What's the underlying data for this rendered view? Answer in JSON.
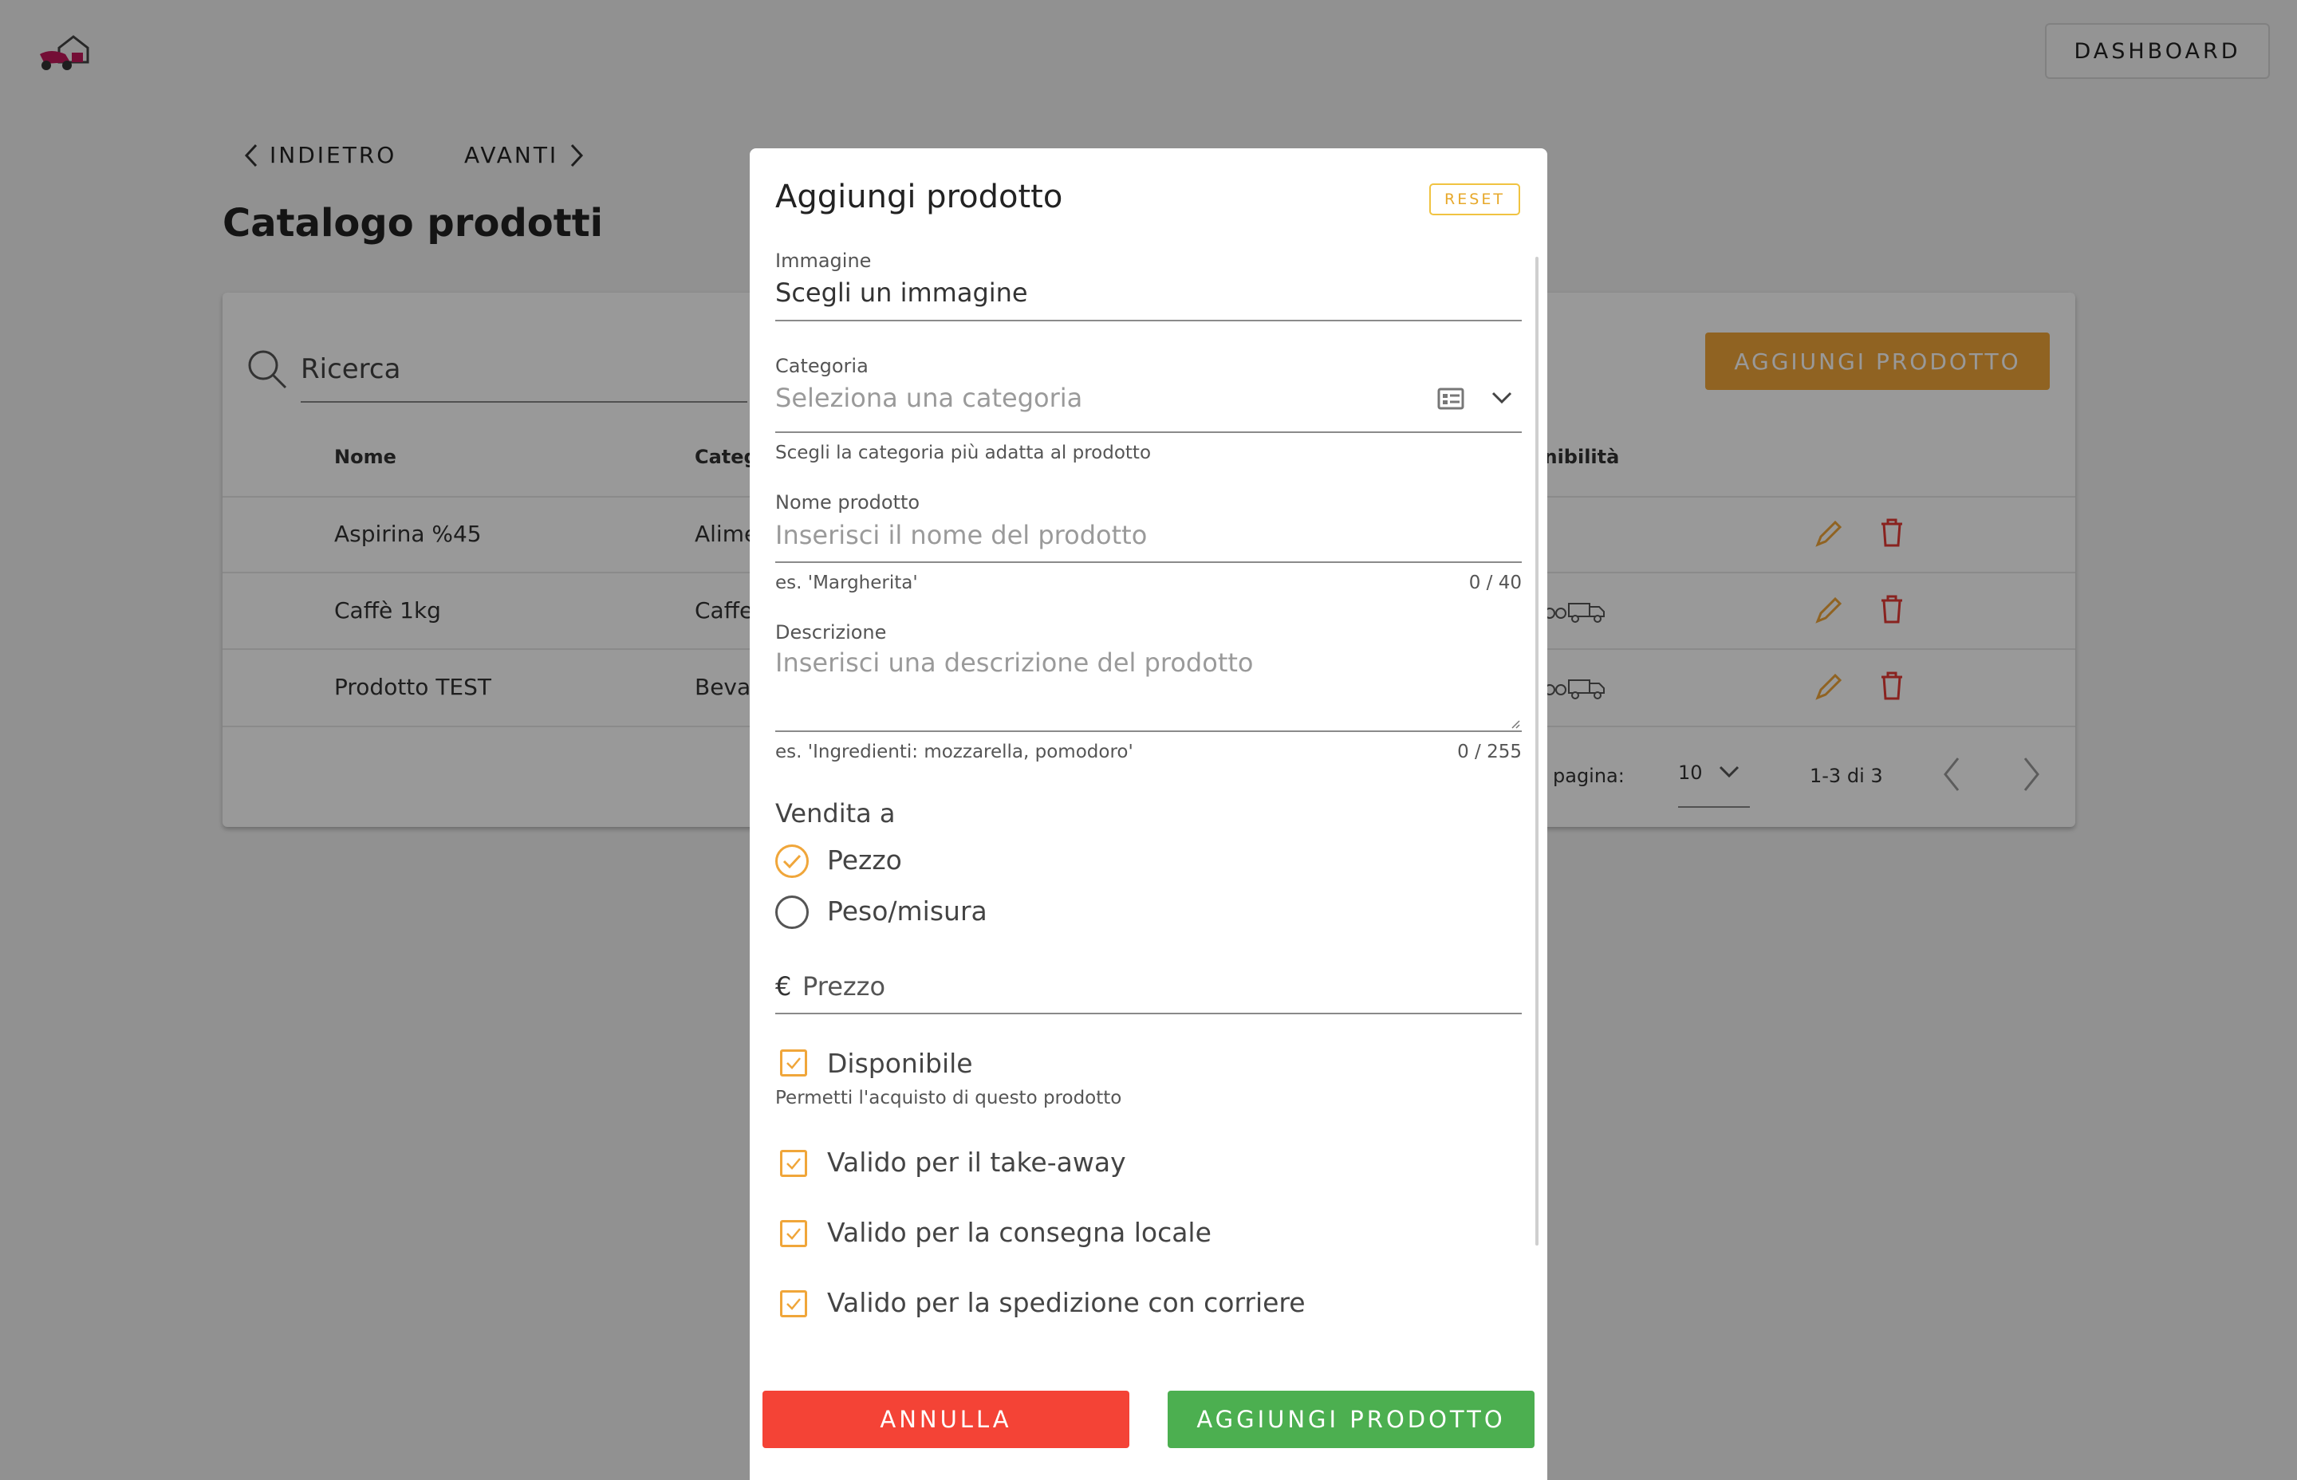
{
  "header": {
    "dashboard_label": "DASHBOARD"
  },
  "nav": {
    "back_label": "INDIETRO",
    "forward_label": "AVANTI"
  },
  "page": {
    "title": "Catalogo prodotti"
  },
  "catalog": {
    "search_placeholder": "Ricerca",
    "add_button_label": "AGGIUNGI PRODOTTO",
    "columns": {
      "name": "Nome",
      "category": "Categ",
      "availability": "onibilità"
    },
    "rows": [
      {
        "name": "Aspirina %45",
        "category": "Alime"
      },
      {
        "name": "Caffè 1kg",
        "category": "Caffe"
      },
      {
        "name": "Prodotto TEST",
        "category": "Beva"
      }
    ],
    "pagination": {
      "rows_label": "pagina:",
      "rows_value": "10",
      "range": "1-3 di 3"
    }
  },
  "dialog": {
    "title": "Aggiungi prodotto",
    "reset_label": "RESET",
    "image": {
      "label": "Immagine",
      "value": "Scegli un immagine"
    },
    "category": {
      "label": "Categoria",
      "placeholder": "Seleziona una categoria",
      "hint": "Scegli la categoria più adatta al prodotto"
    },
    "name": {
      "label": "Nome prodotto",
      "placeholder": "Inserisci il nome del prodotto",
      "hint": "es. 'Margherita'",
      "counter": "0 / 40"
    },
    "description": {
      "label": "Descrizione",
      "placeholder": "Inserisci una descrizione del prodotto",
      "hint": "es. 'Ingredienti: mozzarella, pomodoro'",
      "counter": "0 / 255"
    },
    "sale": {
      "title": "Vendita a",
      "options": [
        {
          "label": "Pezzo",
          "selected": true
        },
        {
          "label": "Peso/misura",
          "selected": false
        }
      ]
    },
    "price": {
      "currency": "€",
      "placeholder": "Prezzo"
    },
    "available": {
      "label": "Disponibile",
      "hint": "Permetti l'acquisto di questo prodotto",
      "checked": true
    },
    "flags": [
      {
        "label": "Valido per il take-away",
        "checked": true
      },
      {
        "label": "Valido per la consegna locale",
        "checked": true
      },
      {
        "label": "Valido per la spedizione con corriere",
        "checked": true
      }
    ],
    "cancel_label": "ANNULLA",
    "submit_label": "AGGIUNGI PRODOTTO"
  },
  "colors": {
    "accent": "#f0a63a",
    "danger": "#f44336",
    "success": "#4caf50",
    "delete_icon": "#e53935"
  }
}
